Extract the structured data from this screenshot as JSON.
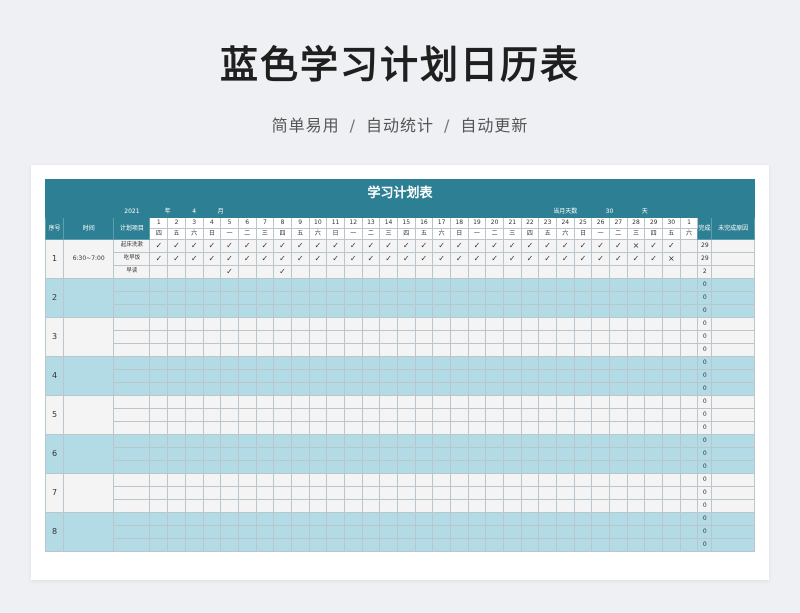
{
  "header": {
    "title": "蓝色学习计划日历表",
    "subtitle_items": [
      "简单易用",
      "自动统计",
      "自动更新"
    ],
    "separator": "/"
  },
  "sheet": {
    "title": "学习计划表",
    "year": "2021",
    "year_label": "年",
    "month": "4",
    "month_label": "月",
    "days_label": "当月天数",
    "days_value": "30",
    "days_unit": "天",
    "col_seq": "序号",
    "col_time": "时间",
    "col_item": "计划项目",
    "col_done": "完成天数",
    "col_reason": "未完成原因",
    "days": [
      "1",
      "2",
      "3",
      "4",
      "5",
      "6",
      "7",
      "8",
      "9",
      "10",
      "11",
      "12",
      "13",
      "14",
      "15",
      "16",
      "17",
      "18",
      "19",
      "20",
      "21",
      "22",
      "23",
      "24",
      "25",
      "26",
      "27",
      "28",
      "29",
      "30",
      "1"
    ],
    "weekdays": [
      "四",
      "五",
      "六",
      "日",
      "一",
      "二",
      "三",
      "四",
      "五",
      "六",
      "日",
      "一",
      "二",
      "三",
      "四",
      "五",
      "六",
      "日",
      "一",
      "二",
      "三",
      "四",
      "五",
      "六",
      "日",
      "一",
      "二",
      "三",
      "四",
      "五",
      "六"
    ],
    "weekend_cols": [
      2,
      3,
      9,
      10,
      16,
      17,
      23,
      24,
      30
    ],
    "rows": [
      {
        "seq": "1",
        "time": "6:30~7:00",
        "shade": "light",
        "items": [
          {
            "name": "起床洗漱",
            "marks": [
              "✓",
              "✓",
              "✓",
              "✓",
              "✓",
              "✓",
              "✓",
              "✓",
              "✓",
              "✓",
              "✓",
              "✓",
              "✓",
              "✓",
              "✓",
              "✓",
              "✓",
              "✓",
              "✓",
              "✓",
              "✓",
              "✓",
              "✓",
              "✓",
              "✓",
              "✓",
              "✓",
              "×",
              "✓",
              "✓",
              ""
            ],
            "count": "29"
          },
          {
            "name": "吃早饭",
            "marks": [
              "✓",
              "✓",
              "✓",
              "✓",
              "✓",
              "✓",
              "✓",
              "✓",
              "✓",
              "✓",
              "✓",
              "✓",
              "✓",
              "✓",
              "✓",
              "✓",
              "✓",
              "✓",
              "✓",
              "✓",
              "✓",
              "✓",
              "✓",
              "✓",
              "✓",
              "✓",
              "✓",
              "✓",
              "✓",
              "×",
              ""
            ],
            "count": "29"
          },
          {
            "name": "早读",
            "marks": [
              "",
              "",
              "",
              "",
              "✓",
              "",
              "",
              "✓",
              "",
              "",
              "",
              "",
              "",
              "",
              "",
              "",
              "",
              "",
              "",
              "",
              "",
              "",
              "",
              "",
              "",
              "",
              "",
              "",
              "",
              "",
              ""
            ],
            "count": "2"
          }
        ]
      },
      {
        "seq": "2",
        "time": "",
        "shade": "blue",
        "items": [
          {
            "name": "",
            "marks": [],
            "count": "0"
          },
          {
            "name": "",
            "marks": [],
            "count": "0"
          },
          {
            "name": "",
            "marks": [],
            "count": "0"
          }
        ]
      },
      {
        "seq": "3",
        "time": "",
        "shade": "light",
        "items": [
          {
            "name": "",
            "marks": [],
            "count": "0"
          },
          {
            "name": "",
            "marks": [],
            "count": "0"
          },
          {
            "name": "",
            "marks": [],
            "count": "0"
          }
        ]
      },
      {
        "seq": "4",
        "time": "",
        "shade": "blue",
        "items": [
          {
            "name": "",
            "marks": [],
            "count": "0"
          },
          {
            "name": "",
            "marks": [],
            "count": "0"
          },
          {
            "name": "",
            "marks": [],
            "count": "0"
          }
        ]
      },
      {
        "seq": "5",
        "time": "",
        "shade": "light",
        "items": [
          {
            "name": "",
            "marks": [],
            "count": "0"
          },
          {
            "name": "",
            "marks": [],
            "count": "0"
          },
          {
            "name": "",
            "marks": [],
            "count": "0"
          }
        ]
      },
      {
        "seq": "6",
        "time": "",
        "shade": "blue",
        "items": [
          {
            "name": "",
            "marks": [],
            "count": "0"
          },
          {
            "name": "",
            "marks": [],
            "count": "0"
          },
          {
            "name": "",
            "marks": [],
            "count": "0"
          }
        ]
      },
      {
        "seq": "7",
        "time": "",
        "shade": "light",
        "items": [
          {
            "name": "",
            "marks": [],
            "count": "0"
          },
          {
            "name": "",
            "marks": [],
            "count": "0"
          },
          {
            "name": "",
            "marks": [],
            "count": "0"
          }
        ]
      },
      {
        "seq": "8",
        "time": "",
        "shade": "blue",
        "items": [
          {
            "name": "",
            "marks": [],
            "count": "0"
          },
          {
            "name": "",
            "marks": [],
            "count": "0"
          },
          {
            "name": "",
            "marks": [],
            "count": "0"
          }
        ]
      }
    ]
  }
}
